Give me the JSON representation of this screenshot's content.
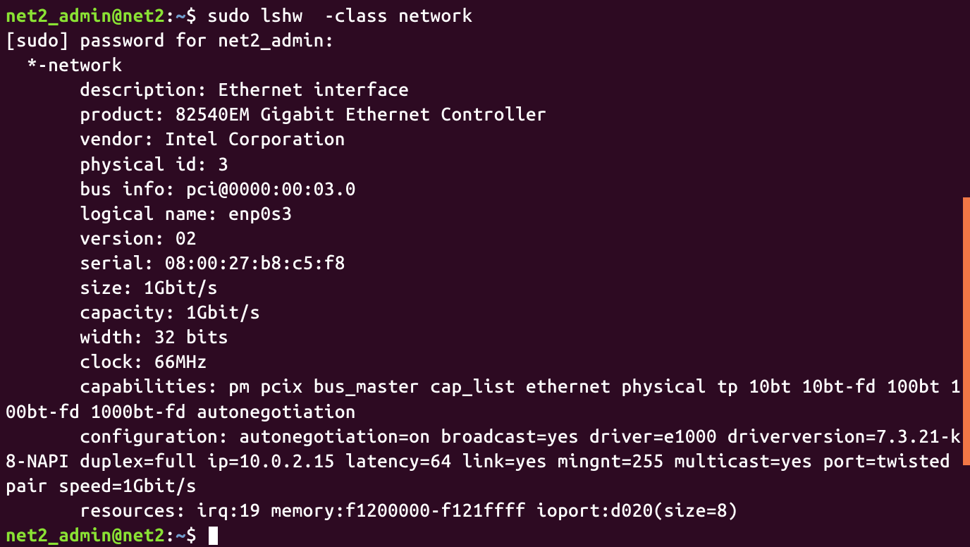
{
  "prompt1": {
    "user": "net2_admin@net2",
    "colon": ":",
    "path": "~",
    "dollar": "$ ",
    "command": "sudo lshw  -class network"
  },
  "output": {
    "l0": "[sudo] password for net2_admin:",
    "l1": "  *-network",
    "l2": "       description: Ethernet interface",
    "l3": "       product: 82540EM Gigabit Ethernet Controller",
    "l4": "       vendor: Intel Corporation",
    "l5": "       physical id: 3",
    "l6": "       bus info: pci@0000:00:03.0",
    "l7": "       logical name: enp0s3",
    "l8": "       version: 02",
    "l9": "       serial: 08:00:27:b8:c5:f8",
    "l10": "       size: 1Gbit/s",
    "l11": "       capacity: 1Gbit/s",
    "l12": "       width: 32 bits",
    "l13": "       clock: 66MHz",
    "l14": "       capabilities: pm pcix bus_master cap_list ethernet physical tp 10bt 10bt-fd 100bt 100bt-fd 1000bt-fd autonegotiation",
    "l15": "       configuration: autonegotiation=on broadcast=yes driver=e1000 driverversion=7.3.21-k8-NAPI duplex=full ip=10.0.2.15 latency=64 link=yes mingnt=255 multicast=yes port=twisted pair speed=1Gbit/s",
    "l16": "       resources: irq:19 memory:f1200000-f121ffff ioport:d020(size=8)"
  },
  "prompt2": {
    "user": "net2_admin@net2",
    "colon": ":",
    "path": "~",
    "dollar": "$ "
  }
}
